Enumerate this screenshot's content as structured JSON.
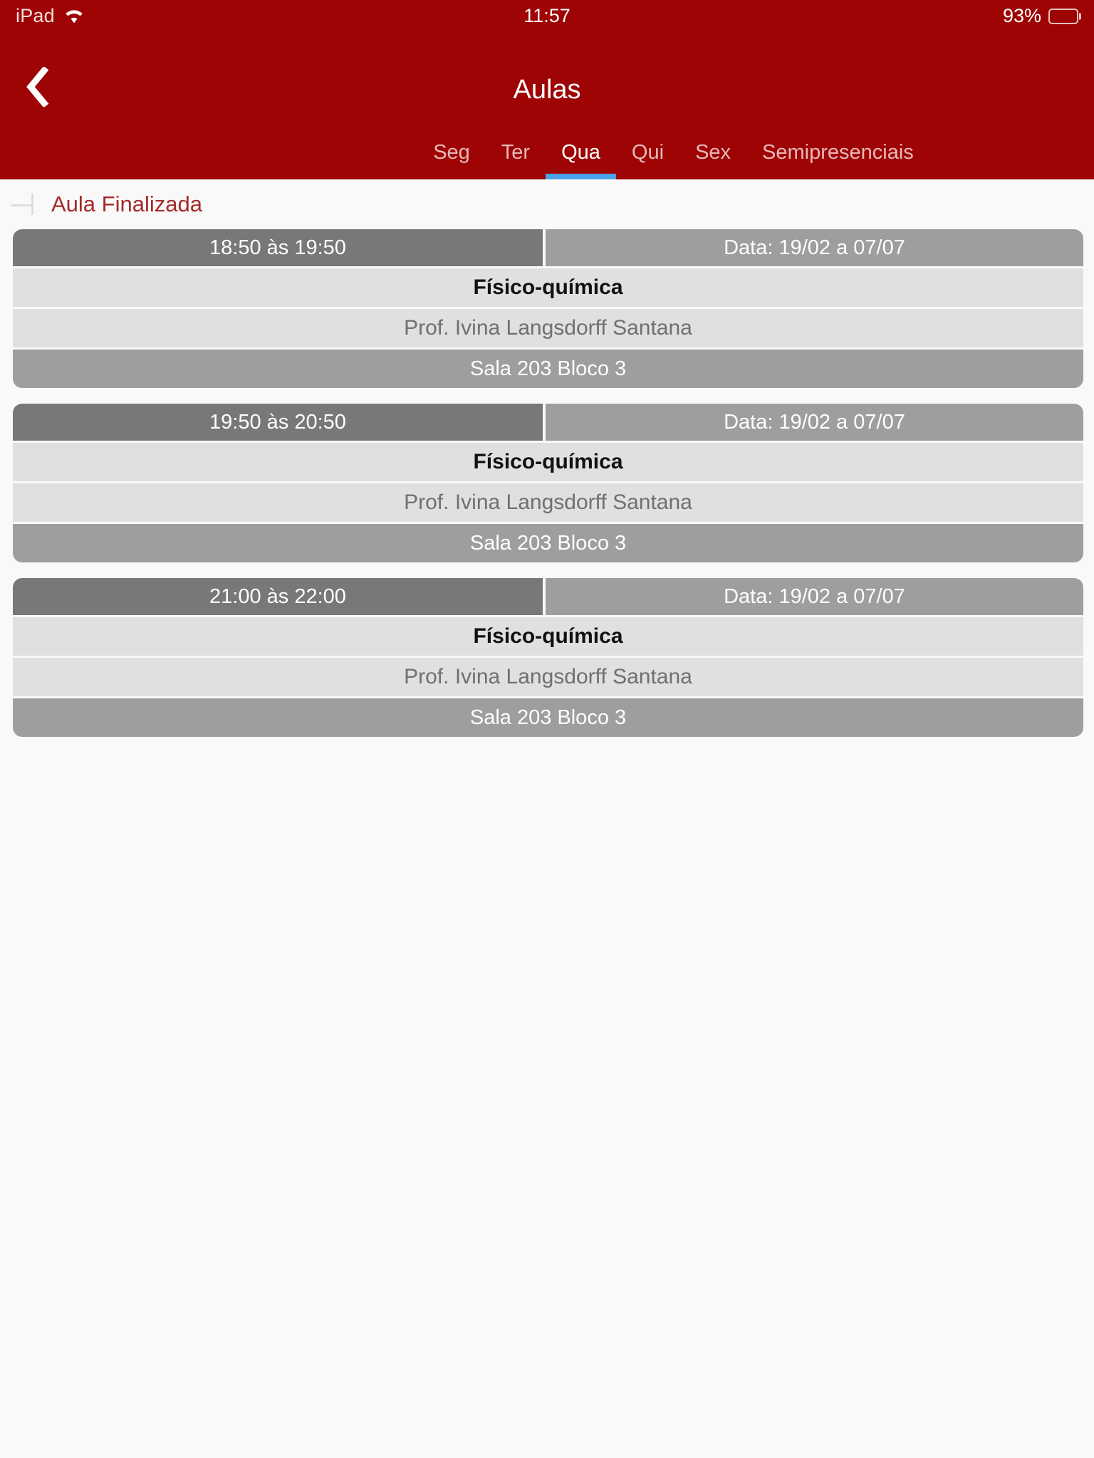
{
  "status_bar": {
    "carrier": "iPad",
    "wifi_icon": "wifi-icon",
    "time": "11:57",
    "battery_percent": "93%",
    "battery_icon": "battery-icon",
    "battery_level": 93
  },
  "nav_bar": {
    "back_icon": "chevron-left-icon",
    "title": "Aulas"
  },
  "tabs": {
    "active_index": 2,
    "indicator_color": "#4aa3e8",
    "items": [
      {
        "label": "Seg"
      },
      {
        "label": "Ter"
      },
      {
        "label": "Qua"
      },
      {
        "label": "Qui"
      },
      {
        "label": "Sex"
      },
      {
        "label": "Semipresenciais"
      }
    ]
  },
  "section": {
    "bracket_icon": "tree-bracket-icon",
    "title": "Aula Finalizada",
    "title_color": "#a52a2a"
  },
  "classes": [
    {
      "time": "18:50 às 19:50",
      "date": "Data: 19/02 a 07/07",
      "subject": "Físico-química",
      "professor": "Prof. Ivina Langsdorff Santana",
      "room": "Sala 203 Bloco 3"
    },
    {
      "time": "19:50 às 20:50",
      "date": "Data: 19/02 a 07/07",
      "subject": "Físico-química",
      "professor": "Prof. Ivina Langsdorff Santana",
      "room": "Sala 203 Bloco 3"
    },
    {
      "time": "21:00 às 22:00",
      "date": "Data: 19/02 a 07/07",
      "subject": "Físico-química",
      "professor": "Prof. Ivina Langsdorff Santana",
      "room": "Sala 203 Bloco 3"
    }
  ],
  "theme": {
    "brand_red": "#9e0404",
    "background": "#f9f9f9",
    "header_dark_gray": "#787878",
    "header_mid_gray": "#9e9e9e",
    "row_light_gray": "#e0e0e0"
  }
}
